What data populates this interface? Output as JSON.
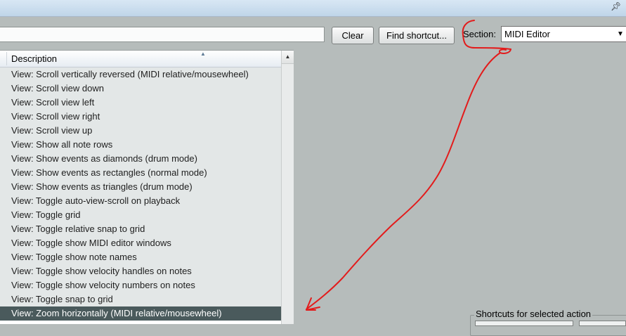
{
  "titlebar": {
    "pin_icon": "pin-icon"
  },
  "toolbar": {
    "filter_value": "",
    "clear_label": "Clear",
    "find_label": "Find shortcut...",
    "section_label": "Section:",
    "section_value": "MIDI Editor",
    "chevron_icon": "chevron-down-icon"
  },
  "list": {
    "header": "Description",
    "sort_icon": "sort-ascending-icon",
    "rows": [
      "View: Scroll vertically reversed (MIDI relative/mousewheel)",
      "View: Scroll view down",
      "View: Scroll view left",
      "View: Scroll view right",
      "View: Scroll view up",
      "View: Show all note rows",
      "View: Show events as diamonds (drum mode)",
      "View: Show events as rectangles (normal mode)",
      "View: Show events as triangles (drum mode)",
      "View: Toggle auto-view-scroll on playback",
      "View: Toggle grid",
      "View: Toggle relative snap to grid",
      "View: Toggle show MIDI editor windows",
      "View: Toggle show note names",
      "View: Toggle show velocity handles on notes",
      "View: Toggle show velocity numbers on notes",
      "View: Toggle snap to grid",
      "View: Zoom horizontally (MIDI relative/mousewheel)"
    ],
    "selected_index": 17
  },
  "shortcuts_group": {
    "title": "Shortcuts for selected action"
  },
  "colors": {
    "background": "#b6bcbb",
    "selected_row": "#4a5a5c",
    "annotation": "#e31b1b"
  }
}
